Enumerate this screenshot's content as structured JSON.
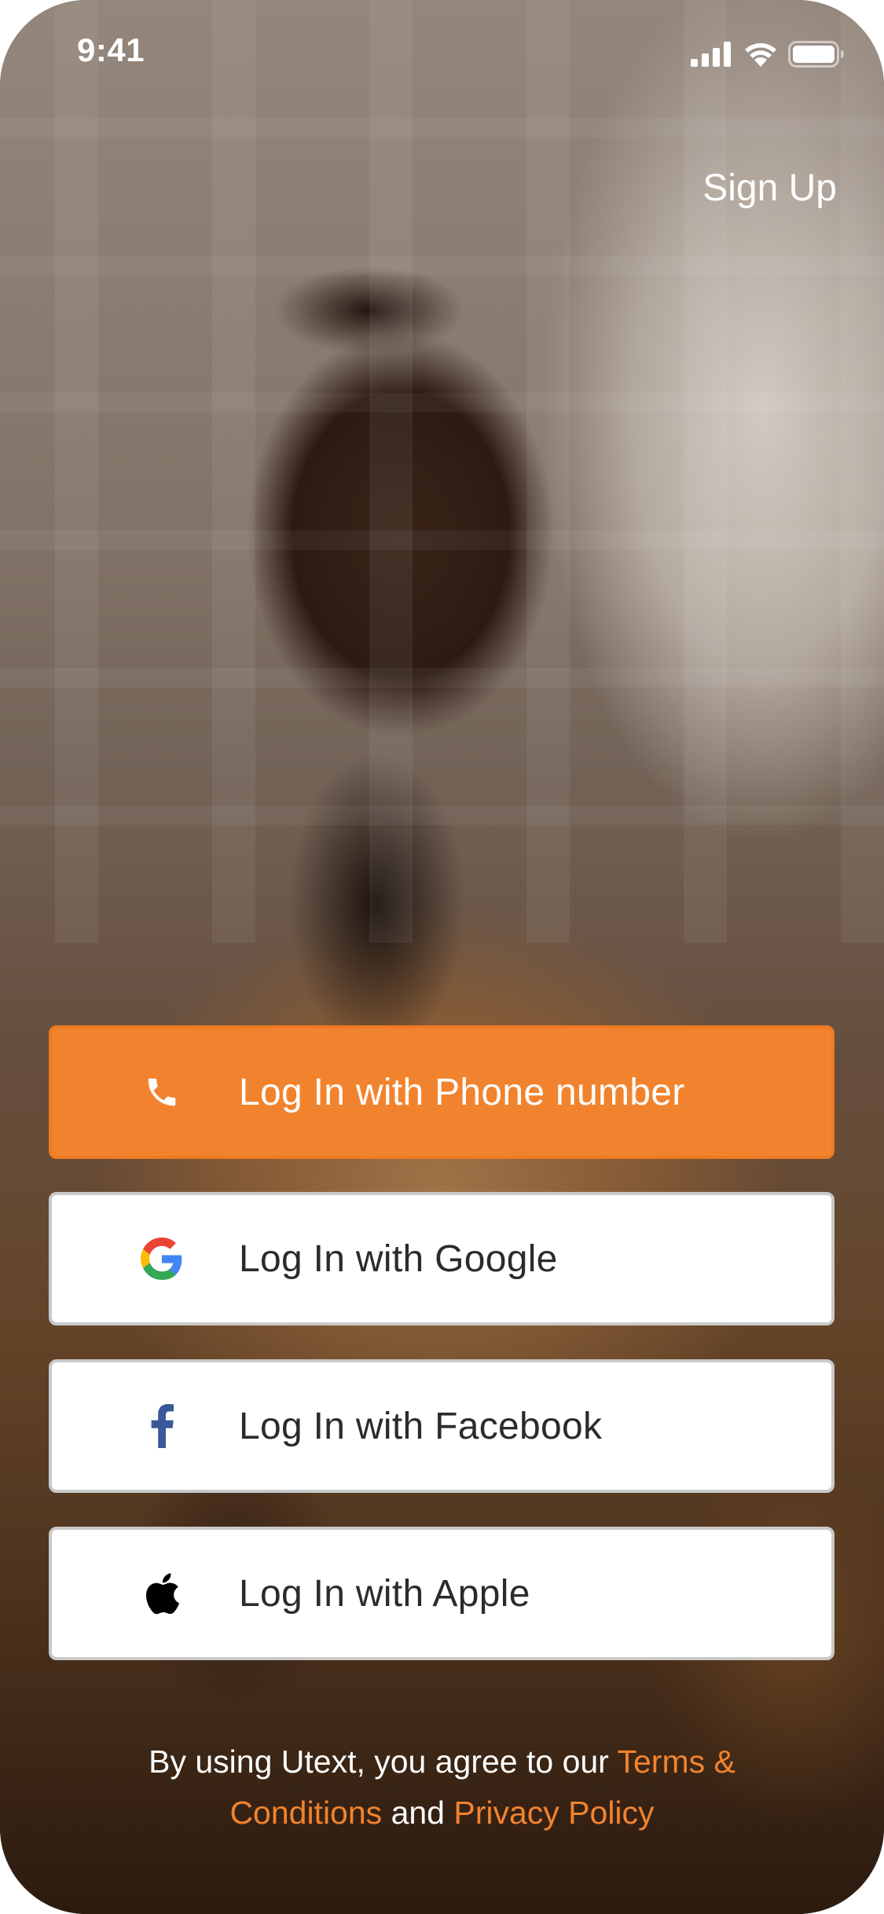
{
  "status_bar": {
    "time": "9:41",
    "icons": [
      "cellular-signal-icon",
      "wifi-icon",
      "battery-icon"
    ]
  },
  "header": {
    "signup_label": "Sign Up"
  },
  "login_buttons": [
    {
      "id": "phone",
      "label": "Log In with Phone number",
      "icon": "phone-icon"
    },
    {
      "id": "google",
      "label": "Log In with Google",
      "icon": "google-icon"
    },
    {
      "id": "facebook",
      "label": "Log In with Facebook",
      "icon": "facebook-icon"
    },
    {
      "id": "apple",
      "label": "Log In with Apple",
      "icon": "apple-icon"
    }
  ],
  "terms": {
    "prefix": "By using Utext, you agree to our ",
    "terms_link": "Terms & Conditions",
    "connector": " and ",
    "privacy_link": "Privacy Policy"
  },
  "colors": {
    "accent": "#f2832e",
    "button_white": "#ffffff",
    "button_border": "#c9c9c9",
    "text_dark": "#2b2b2b"
  }
}
